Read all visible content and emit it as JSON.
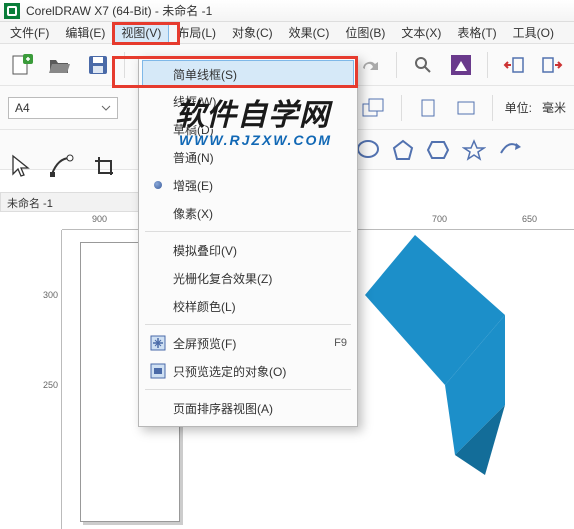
{
  "title": "CorelDRAW X7 (64-Bit) - 未命名 -1",
  "menubar": {
    "file": "文件(F)",
    "edit": "编辑(E)",
    "view": "视图(V)",
    "layout": "布局(L)",
    "object": "对象(C)",
    "effects": "效果(C)",
    "bitmap": "位图(B)",
    "text": "文本(X)",
    "table": "表格(T)",
    "tools": "工具(O)"
  },
  "dropdown": {
    "simple_wireframe": "简单线框(S)",
    "wireframe": "线框(W)",
    "draft": "草稿(D)",
    "normal": "普通(N)",
    "enhanced": "增强(E)",
    "pixels": "像素(X)",
    "simulate_overprint": "模拟叠印(V)",
    "rasterize_effects": "光栅化复合效果(Z)",
    "proof_colors": "校样颜色(L)",
    "fullscreen_preview": "全屏预览(F)",
    "fullscreen_shortcut": "F9",
    "preview_selected": "只预览选定的对象(O)",
    "page_sorter": "页面排序器视图(A)"
  },
  "toolbar2": {
    "paper": "A4",
    "unit_label": "单位:",
    "unit_value": "毫米"
  },
  "doc_tab": "未命名 -1",
  "ruler_h": {
    "t1": "900",
    "t2": "700",
    "t3": "650"
  },
  "ruler_v": {
    "t1": "300",
    "t2": "250"
  },
  "watermark": {
    "line1": "软件自学网",
    "line2": "WWW.RJZXW.COM"
  }
}
